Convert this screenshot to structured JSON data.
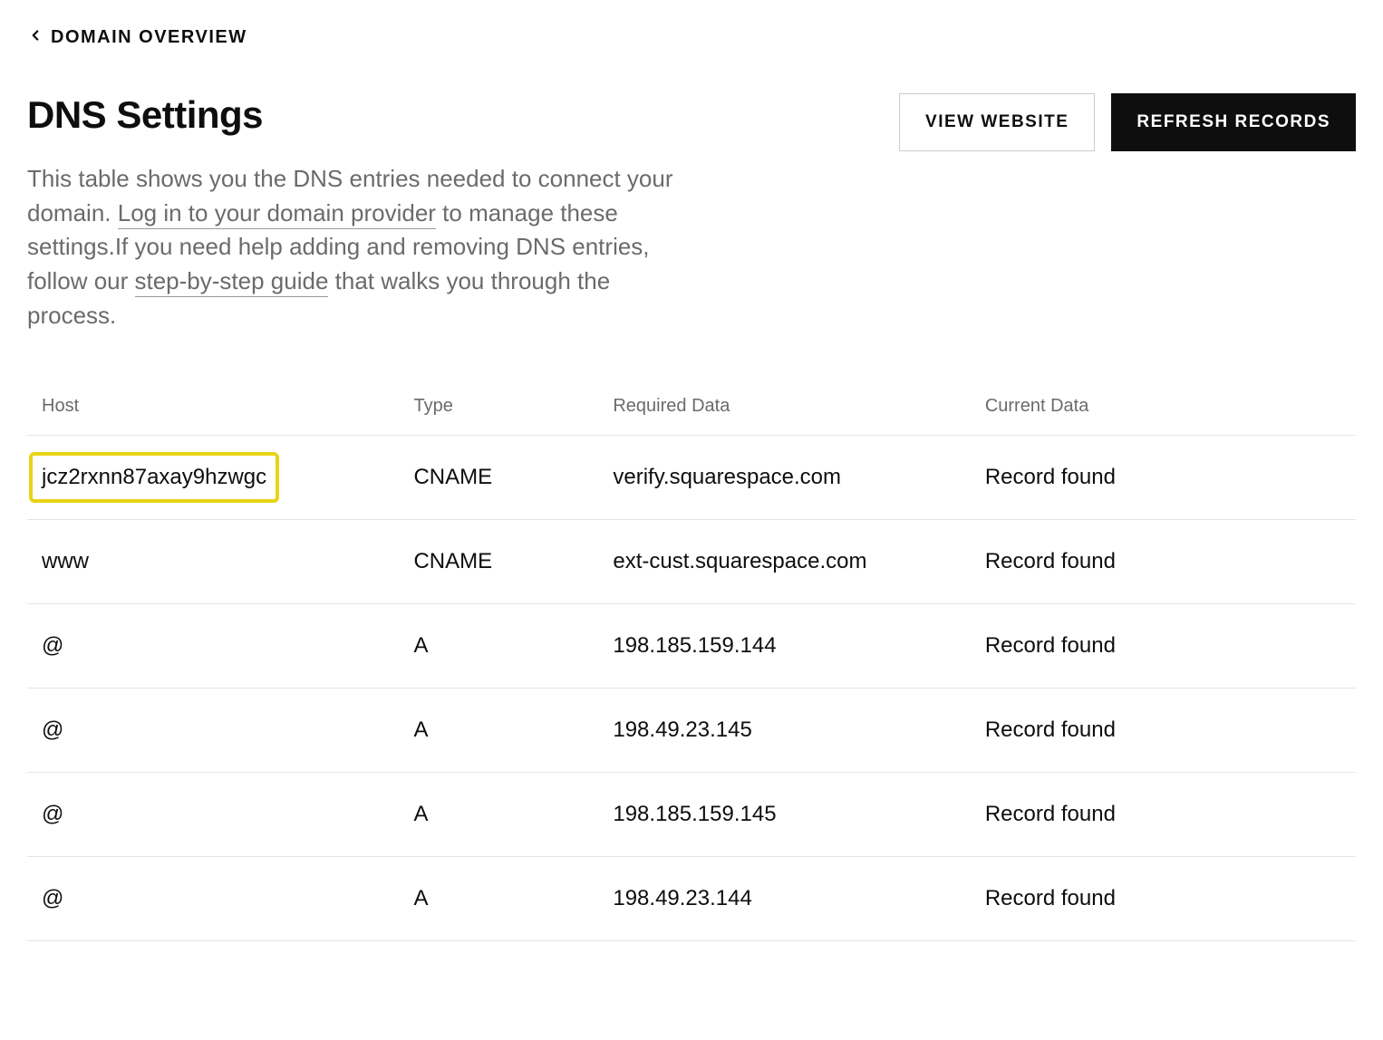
{
  "breadcrumb": {
    "label": "DOMAIN OVERVIEW"
  },
  "header": {
    "title": "DNS Settings",
    "view_website_label": "VIEW WEBSITE",
    "refresh_records_label": "REFRESH RECORDS"
  },
  "description": {
    "part1": "This table shows you the DNS entries needed to connect your domain. ",
    "link1": "Log in to your domain provider",
    "part2": " to manage these settings.If you need help adding and removing DNS entries, follow our ",
    "link2": "step-by-step guide",
    "part3": " that walks you through the process."
  },
  "table": {
    "headers": {
      "host": "Host",
      "type": "Type",
      "required_data": "Required Data",
      "current_data": "Current Data"
    },
    "rows": [
      {
        "host": "jcz2rxnn87axay9hzwgc",
        "type": "CNAME",
        "required_data": "verify.squarespace.com",
        "current_data": "Record found",
        "highlighted": true
      },
      {
        "host": "www",
        "type": "CNAME",
        "required_data": "ext-cust.squarespace.com",
        "current_data": "Record found",
        "highlighted": false
      },
      {
        "host": "@",
        "type": "A",
        "required_data": "198.185.159.144",
        "current_data": "Record found",
        "highlighted": false
      },
      {
        "host": "@",
        "type": "A",
        "required_data": "198.49.23.145",
        "current_data": "Record found",
        "highlighted": false
      },
      {
        "host": "@",
        "type": "A",
        "required_data": "198.185.159.145",
        "current_data": "Record found",
        "highlighted": false
      },
      {
        "host": "@",
        "type": "A",
        "required_data": "198.49.23.144",
        "current_data": "Record found",
        "highlighted": false
      }
    ]
  }
}
